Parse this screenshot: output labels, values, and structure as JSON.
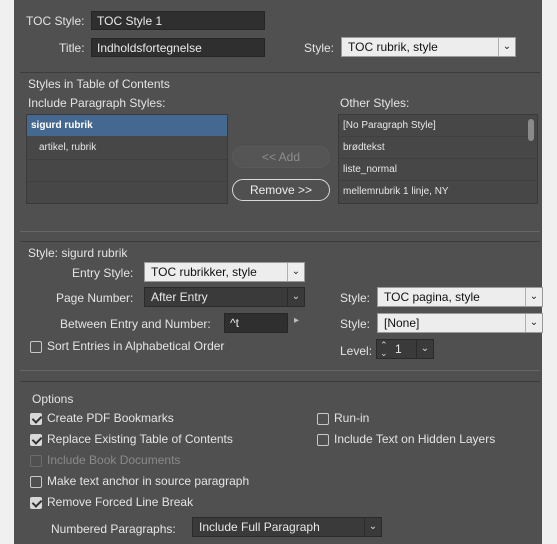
{
  "toc_style": {
    "label": "TOC Style:",
    "value": "TOC Style 1"
  },
  "title": {
    "label": "Title:",
    "value": "Indholdsfortegnelse"
  },
  "title_style": {
    "label": "Style:",
    "value": "TOC rubrik, style"
  },
  "styles_section": {
    "heading": "Styles in Table of Contents",
    "include_label": "Include Paragraph Styles:",
    "include_items": [
      {
        "label": "sigurd rubrik",
        "selected": true
      },
      {
        "label": "artikel, rubrik",
        "selected": false
      }
    ],
    "other_label": "Other Styles:",
    "other_items": [
      "[No Paragraph Style]",
      "brødtekst",
      "liste_normal",
      "mellemrubrik 1 linje, NY"
    ],
    "add_button": "<< Add",
    "remove_button": "Remove >>"
  },
  "style_section": {
    "heading": "Style: sigurd rubrik",
    "entry_style_label": "Entry Style:",
    "entry_style_value": "TOC rubrikker, style",
    "page_number_label": "Page Number:",
    "page_number_value": "After Entry",
    "page_style_label": "Style:",
    "page_style_value": "TOC pagina, style",
    "between_label": "Between Entry and Number:",
    "between_value": "^t",
    "between_style_label": "Style:",
    "between_style_value": "[None]",
    "sort_label": "Sort Entries in Alphabetical Order",
    "sort_checked": false,
    "level_label": "Level:",
    "level_value": "1"
  },
  "options": {
    "heading": "Options",
    "create_pdf": {
      "label": "Create PDF Bookmarks",
      "checked": true
    },
    "replace_toc": {
      "label": "Replace Existing Table of Contents",
      "checked": true
    },
    "include_book": {
      "label": "Include Book Documents",
      "checked": false,
      "disabled": true
    },
    "make_anchor": {
      "label": "Make text anchor in source paragraph",
      "checked": false
    },
    "remove_break": {
      "label": "Remove Forced Line Break",
      "checked": true
    },
    "run_in": {
      "label": "Run-in",
      "checked": false
    },
    "hidden_layers": {
      "label": "Include Text on Hidden Layers",
      "checked": false
    },
    "numbered_label": "Numbered Paragraphs:",
    "numbered_value": "Include Full Paragraph"
  },
  "colors": {
    "panel": "#505050",
    "selection": "#44688f",
    "field": "#2f2f2f"
  }
}
